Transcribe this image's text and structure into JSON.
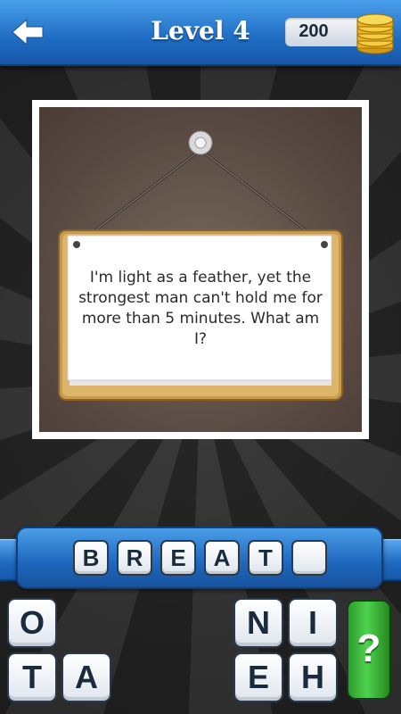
{
  "header": {
    "title": "Level 4",
    "coins": "200"
  },
  "riddle": {
    "text": "I'm light as a feather, yet the strongest man can't hold me for more than 5 minutes. What am I?"
  },
  "answer": {
    "slots": [
      "B",
      "R",
      "E",
      "A",
      "T",
      ""
    ]
  },
  "letter_pool": {
    "row1": [
      "O",
      "",
      "",
      "",
      "N",
      "I"
    ],
    "row2": [
      "T",
      "A",
      "",
      "",
      "E",
      "H"
    ]
  },
  "hint_button": {
    "label": "?"
  },
  "colors": {
    "header_blue": "#1f6cc4",
    "hint_green": "#3fbf3f",
    "coin_gold": "#f2c12e"
  }
}
